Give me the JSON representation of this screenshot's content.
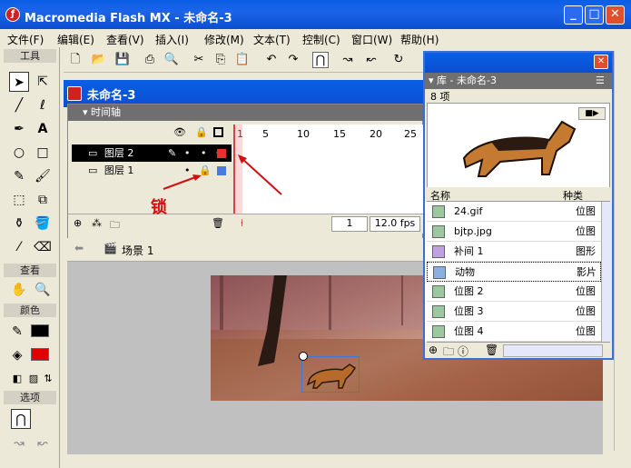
{
  "app": {
    "title": "Macromedia Flash MX - 未命名-3",
    "icon": "flash-logo-icon"
  },
  "window_buttons": [
    "minimize",
    "maximize",
    "close"
  ],
  "menu": [
    "文件(F)",
    "编辑(E)",
    "查看(V)",
    "插入(I)",
    "修改(M)",
    "文本(T)",
    "控制(C)",
    "窗口(W)",
    "帮助(H)"
  ],
  "toolbox": {
    "header": "工具",
    "view_header": "查看",
    "colors_header": "颜色",
    "options_header": "选项"
  },
  "document": {
    "title": "未命名-3"
  },
  "timeline": {
    "header": "时间轴",
    "frame_numbers": [
      "1",
      "5",
      "10",
      "15",
      "20",
      "25"
    ],
    "layers": [
      {
        "name": "图层 2",
        "selected": true,
        "color": "#e83030"
      },
      {
        "name": "图层 1",
        "selected": false,
        "color": "#4a7adf"
      }
    ],
    "current_frame": "1",
    "fps": "12.0 fps"
  },
  "annotation": {
    "text": "锁"
  },
  "scene": {
    "label": "场景 1"
  },
  "library": {
    "title": "库 - 未命名-3",
    "count": "8 项",
    "col_name": "名称",
    "col_kind": "种类",
    "items": [
      {
        "name": "24.gif",
        "kind": "位图",
        "icon": "bitmap-icon"
      },
      {
        "name": "bjtp.jpg",
        "kind": "位图",
        "icon": "bitmap-icon"
      },
      {
        "name": "补间 1",
        "kind": "图形",
        "icon": "graphic-icon"
      },
      {
        "name": "动物",
        "kind": "影片",
        "icon": "movieclip-icon"
      },
      {
        "name": "位图 2",
        "kind": "位图",
        "icon": "bitmap-icon"
      },
      {
        "name": "位图 3",
        "kind": "位图",
        "icon": "bitmap-icon"
      },
      {
        "name": "位图 4",
        "kind": "位图",
        "icon": "bitmap-icon"
      }
    ]
  }
}
